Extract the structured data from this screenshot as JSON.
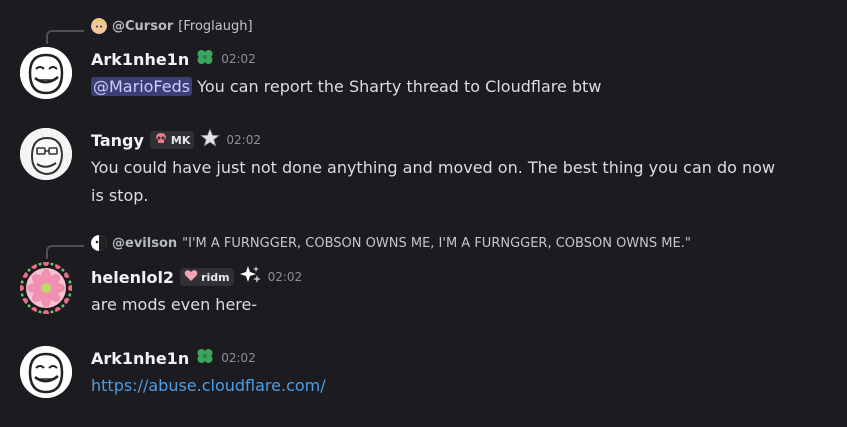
{
  "colors": {
    "background": "#1b1b20",
    "mention_bg": "#3b3f74",
    "mention_text": "#c9cdfb",
    "link": "#4a9fe8",
    "timestamp": "#8d8f96"
  },
  "messages": [
    {
      "reply": {
        "author": "@Cursor",
        "text": "[Froglaugh]"
      },
      "author": "Ark1nhe1n",
      "badge_icon": "clover-icon",
      "time": "02:02",
      "mention": "@MarioFeds",
      "text": " You can report the Sharty thread to Cloudflare btw"
    },
    {
      "author": "Tangy",
      "tag": {
        "icon": "skull-icon",
        "label": "MK"
      },
      "badge_icon": "star-icon",
      "time": "02:02",
      "text_line1": "You could have just not done anything and moved on. The best thing you can do now",
      "text_line2": "is stop."
    },
    {
      "reply": {
        "author": "@evilson",
        "text": "\"I'M A FURNGGER, COBSON OWNS ME, I'M A FURNGGER, COBSON OWNS ME.\""
      },
      "author": "helenlol2",
      "tag": {
        "icon": "heart-icon",
        "label": "ridm"
      },
      "badge_icon": "sparkle-icon",
      "time": "02:02",
      "text": "are mods even here-"
    },
    {
      "author": "Ark1nhe1n",
      "badge_icon": "clover-icon",
      "time": "02:02",
      "link": "https://abuse.cloudflare.com/"
    }
  ]
}
